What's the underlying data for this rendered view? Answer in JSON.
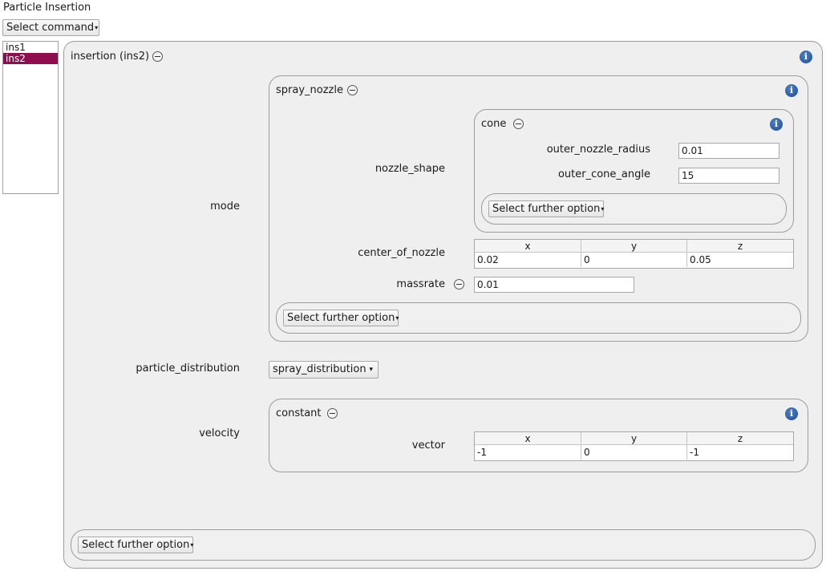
{
  "window": {
    "title": "Particle Insertion"
  },
  "toolbar": {
    "select_command_label": "Select command"
  },
  "insertion_list": {
    "items": [
      "ins1",
      "ins2"
    ],
    "selected": "ins2"
  },
  "insertion": {
    "title": "insertion (ins2)",
    "mode_label": "mode",
    "particle_distribution_label": "particle_distribution",
    "particle_distribution_value": "spray_distribution",
    "velocity_label": "velocity",
    "further_option_label": "Select further option"
  },
  "spray_nozzle": {
    "title": "spray_nozzle",
    "nozzle_shape_label": "nozzle_shape",
    "center_of_nozzle_label": "center_of_nozzle",
    "center_of_nozzle": {
      "headers": [
        "x",
        "y",
        "z"
      ],
      "values": [
        "0.02",
        "0",
        "0.05"
      ]
    },
    "massrate_label": "massrate",
    "massrate_value": "0.01",
    "further_option_label": "Select further option"
  },
  "cone": {
    "title": "cone",
    "outer_nozzle_radius_label": "outer_nozzle_radius",
    "outer_nozzle_radius_value": "0.01",
    "outer_cone_angle_label": "outer_cone_angle",
    "outer_cone_angle_value": "15",
    "further_option_label": "Select further option"
  },
  "constant": {
    "title": "constant",
    "vector_label": "vector",
    "vector": {
      "headers": [
        "x",
        "y",
        "z"
      ],
      "values": [
        "-1",
        "0",
        "-1"
      ]
    }
  },
  "icons": {
    "info": "i",
    "dropdown_arrow": "▾"
  },
  "colors": {
    "selection": "#8f0d4f",
    "info": "#1c4c94"
  }
}
